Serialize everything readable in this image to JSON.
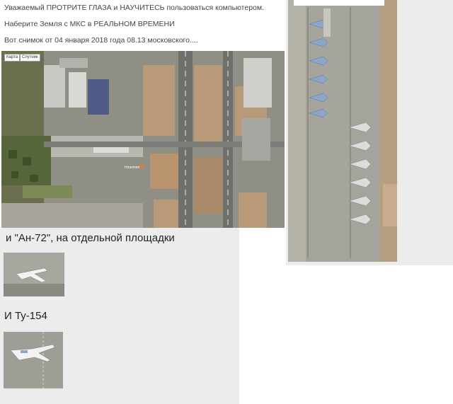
{
  "text": {
    "line1": "Уважаемый ПРОТРИТЕ ГЛАЗА и НАУЧИТЕСЬ пользоваться компьютером.",
    "line2": "Наберите Земля с МКС в РЕАЛЬНОМ ВРЕМЕНИ",
    "line3": "Вот снимок от 04 января 2018 года 08.13 московского....",
    "caption_an72": "и \"Ан-72\", на отдельной площадки",
    "caption_tu154": "И Ту-154"
  },
  "map": {
    "control_map": "Карта",
    "control_sat": "Спутник",
    "label": "Hmeimim"
  },
  "colors": {
    "page_bg": "#ffffff",
    "panel_bg": "#ececec",
    "apron": "#b9b8b0",
    "runway": "#6f6f6c",
    "dirt": "#b89a78",
    "vegetation": "#5f6f3f"
  }
}
